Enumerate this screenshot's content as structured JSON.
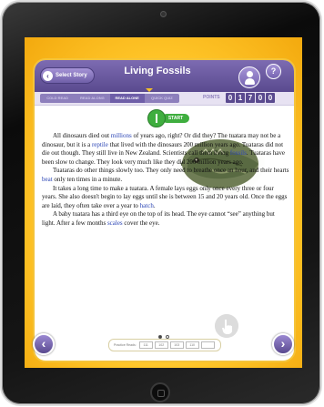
{
  "header": {
    "back_label": "Select Story",
    "title": "Living Fossils",
    "help_label": "?"
  },
  "tabs": [
    {
      "label": "COLD READ"
    },
    {
      "label": "READ ALONG"
    },
    {
      "label": "READ ALONE",
      "active": true
    },
    {
      "label": "QUICK QUIZ"
    }
  ],
  "points": {
    "label": "POINTS",
    "digits": [
      "0",
      "1",
      "7",
      "0",
      "0"
    ]
  },
  "start_button": {
    "label": "START"
  },
  "story": {
    "p1_a": "All dinosaurs died out ",
    "p1_link1": "millions",
    "p1_b": " of years ago, right? Or did they? The tuatara may not be a dinosaur, but it is a ",
    "p1_link2": "reptile",
    "p1_c": " that lived with the dinosaurs 200 million years ago. Tuataras did not die out though. They still live in New Zealand. Scientists call them living ",
    "p1_link3": "fossils",
    "p1_d": ". Tuataras have been slow to change. They look very much like they did 200 million years ago.",
    "p2_a": "Tuataras do other things slowly too. They only need to breathe once an hour, and their hearts ",
    "p2_link": "beat",
    "p2_b": " only ten times in a minute.",
    "p3_a": "It takes a long time to make a tuatara. A female lays eggs only once every three or four years. She also doesn't begin to lay eggs until she is between 15 and 20 years old. Once the eggs are laid, they often take over a year to ",
    "p3_link": "hatch",
    "p3_b": ".",
    "p4_a": "A baby tuatara has a third eye on the top of its head. The eye cannot “see” anything but light. After a few months ",
    "p4_link": "scales",
    "p4_b": " cover the eye."
  },
  "practice": {
    "label": "Practice Reads:",
    "values": [
      "111",
      "102",
      "103",
      "110",
      ""
    ]
  },
  "nav": {
    "prev": "‹",
    "next": "›"
  },
  "colors": {
    "purple": "#5a4a8f",
    "yellow": "#ffc629",
    "green": "#3fae3f",
    "link": "#2b45b5"
  }
}
